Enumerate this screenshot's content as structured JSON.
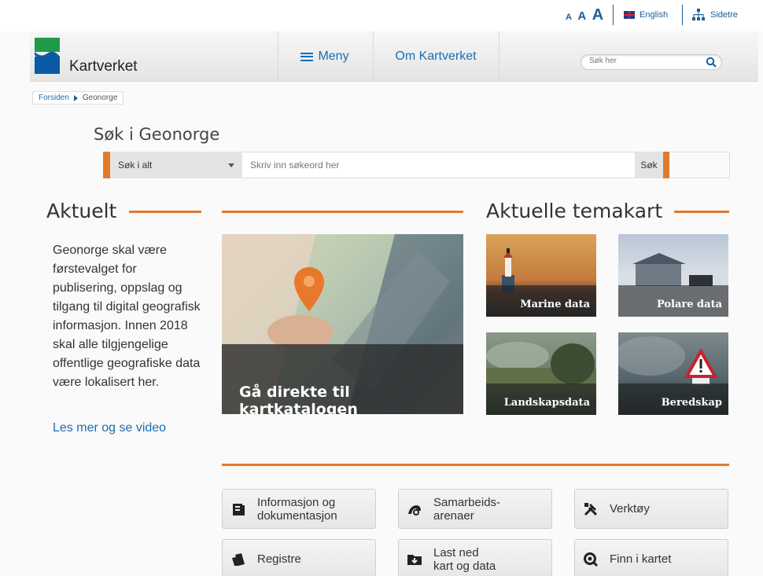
{
  "util": {
    "font_small": "A",
    "font_medium": "A",
    "font_large": "A",
    "english": "English",
    "sitemap": "Sidetre"
  },
  "header": {
    "brand": "Kartverket",
    "menu": "Meny",
    "about": "Om Kartverket",
    "search_placeholder": "Søk her"
  },
  "breadcrumb": [
    "Forsiden",
    "Geonorge"
  ],
  "search": {
    "title": "Søk i Geonorge",
    "scope": "Søk i alt",
    "placeholder": "Skriv inn søkeord her",
    "button": "Søk"
  },
  "aktuelt": {
    "heading": "Aktuelt",
    "body": "Geonorge skal være førstevalget for publisering, oppslag og tilgang til digital geografisk informasjon. Innen 2018 skal alle tilgjengelige offentlige geografiske data være lokalisert her.",
    "link": "Les mer og se video"
  },
  "feature": {
    "label": "Gå direkte til kartkatalogen"
  },
  "temakart": {
    "heading": "Aktuelle temakart",
    "tiles": [
      "Marine data",
      "Polare data",
      "Landskapsdata",
      "Beredskap"
    ]
  },
  "shortcuts": {
    "info": [
      "Informasjon og",
      "dokumentasjon"
    ],
    "samarbeid": [
      "Samarbeids-",
      "arenaer"
    ],
    "verktoy": "Verktøy",
    "registre": "Registre",
    "lastned": [
      "Last ned",
      "kart og data"
    ],
    "finn": "Finn i kartet"
  },
  "colors": {
    "accent": "#e27a2c",
    "link": "#1a6db5"
  }
}
